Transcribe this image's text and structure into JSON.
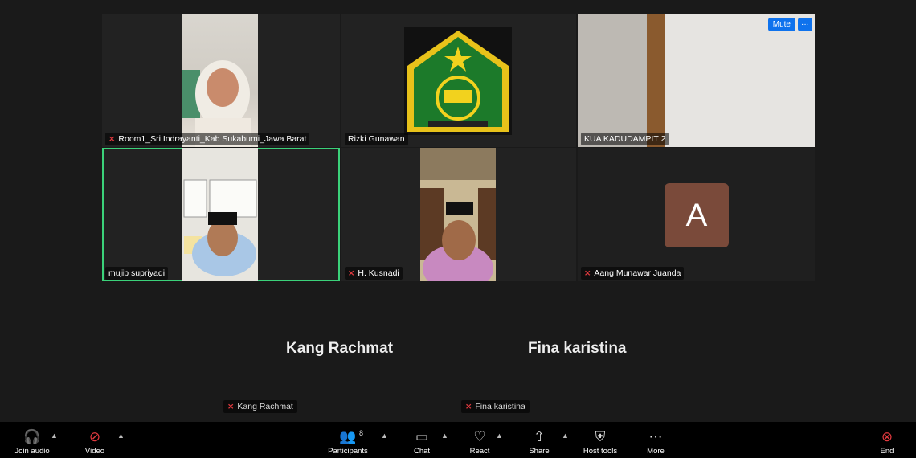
{
  "tiles": [
    {
      "name": "Room1_Sri Indrayanti_Kab Sukabumi_Jawa Barat",
      "muted": true
    },
    {
      "name": "Rizki Gunawan",
      "muted": false
    },
    {
      "name": "KUA KADUDAMPIT 2",
      "muted": false
    },
    {
      "name": "mujib supriyadi",
      "muted": false
    },
    {
      "name": "H. Kusnadi",
      "muted": true
    },
    {
      "name": "Aang Munawar Juanda",
      "muted": true
    }
  ],
  "tile_controls": {
    "mute": "Mute",
    "more": "···"
  },
  "avatar_letter": "A",
  "no_video": [
    {
      "display_name": "Kang Rachmat",
      "tag": "Kang Rachmat"
    },
    {
      "display_name": "Fina karistina",
      "tag": "Fina karistina"
    }
  ],
  "toolbar": {
    "join_audio": "Join audio",
    "video": "Video",
    "participants": "Participants",
    "participants_count": "8",
    "chat": "Chat",
    "react": "React",
    "share": "Share",
    "host_tools": "Host tools",
    "more": "More",
    "end": "End"
  },
  "colors": {
    "active_speaker": "#3bd27a",
    "accent": "#0e72ed",
    "end": "#e0393e",
    "avatar": "#7a4a3a"
  },
  "icons": {
    "mic_off": "mic-off-icon",
    "headphones": "headphones-icon",
    "video_off": "video-off-icon",
    "participants": "participants-icon",
    "chat": "chat-icon",
    "react": "heart-icon",
    "share": "share-icon",
    "host_tools": "shield-icon",
    "more": "more-icon",
    "end": "end-icon"
  }
}
